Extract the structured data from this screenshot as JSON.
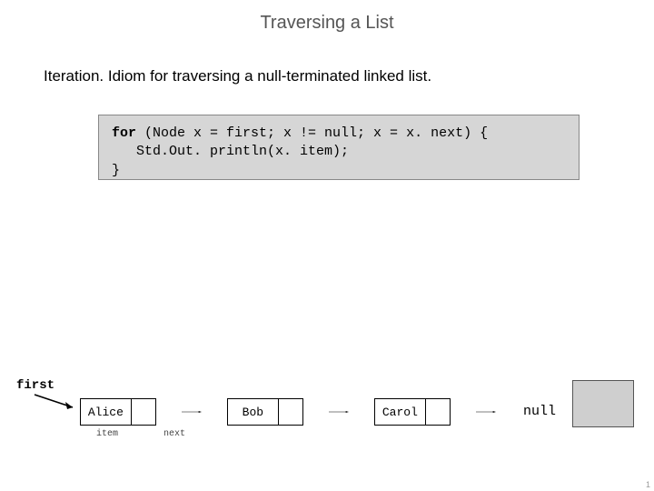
{
  "title": "Traversing a List",
  "desc_lead": "Iteration.",
  "desc_rest": "  Idiom for traversing a null-terminated linked list.",
  "code": {
    "l1a": "for",
    "l1b": " (Node x = first; x != null; x = x. next) {",
    "l2": "   Std.Out. println(x. item);",
    "l3": "}"
  },
  "first_label": "first",
  "nodes": [
    "Alice",
    "Bob",
    "Carol"
  ],
  "null_label": "null",
  "field_item": "item",
  "field_next": "next",
  "page_number": "1"
}
